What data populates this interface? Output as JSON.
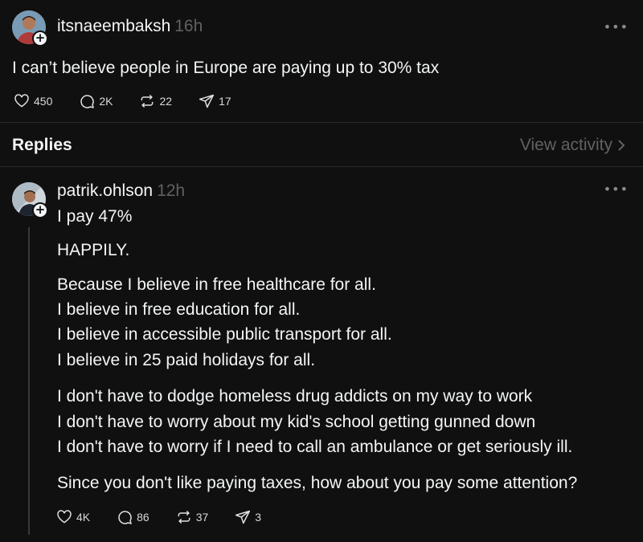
{
  "main_post": {
    "username": "itsnaeembaksh",
    "time": "16h",
    "text": "I can’t believe people in Europe are paying up to 30% tax",
    "likes": "450",
    "comments": "2K",
    "reposts": "22",
    "shares": "17"
  },
  "replies_bar": {
    "title": "Replies",
    "view_activity": "View activity"
  },
  "reply": {
    "username": "patrik.ohlson",
    "time": "12h",
    "lines": [
      "I pay 47%",
      "HAPPILY.",
      "Because I believe in free healthcare for all.",
      "I believe in free education for all.",
      "I believe in accessible public transport for all.",
      "I believe in 25 paid holidays for all.",
      "I don't have to dodge homeless drug addicts on my way to work",
      "I don't have to worry about my kid's school getting gunned down",
      "I don't have to worry if I need to call an ambulance or get seriously ill.",
      "Since you don't like paying taxes, how about you pay some attention?"
    ],
    "likes": "4K",
    "comments": "86",
    "reposts": "37",
    "shares": "3"
  },
  "colors": {
    "background": "#101010",
    "text": "#f3f5f7",
    "muted": "#616161",
    "divider": "#2a2a2a"
  },
  "icons": [
    "heart-icon",
    "comment-icon",
    "repost-icon",
    "share-icon",
    "more-icon",
    "chevron-right-icon",
    "plus-icon"
  ]
}
